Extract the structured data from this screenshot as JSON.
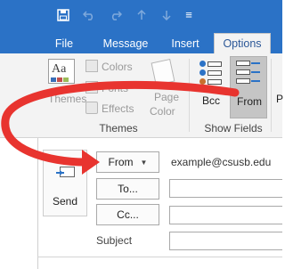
{
  "quick_access": {
    "save_icon": "save-icon",
    "undo_icon": "undo-icon",
    "redo_icon": "redo-icon",
    "up_icon": "up-arrow-icon",
    "down_icon": "down-arrow-icon",
    "more_icon": "customize-menu-icon",
    "more_glyph": "≡"
  },
  "tabs": [
    {
      "label": "File"
    },
    {
      "label": "Message"
    },
    {
      "label": "Insert"
    },
    {
      "label": "Options",
      "active": true
    }
  ],
  "ribbon": {
    "themes_group": {
      "themes_label": "Themes",
      "colors_label": "Colors",
      "fonts_label": "Fonts",
      "effects_label": "Effects",
      "page_color_line1": "Page",
      "page_color_line2": "Color",
      "group_label": "Themes"
    },
    "show_fields_group": {
      "bcc_label": "Bcc",
      "from_label": "From",
      "group_label": "Show Fields"
    },
    "next_cut": "P"
  },
  "compose": {
    "send_label": "Send",
    "from_button": "From",
    "from_value": "example@csusb.edu",
    "to_button": "To...",
    "cc_button": "Cc...",
    "subject_label": "Subject"
  },
  "colors": {
    "accent": "#2b72c6",
    "annotation_arrow": "#e8342f"
  }
}
